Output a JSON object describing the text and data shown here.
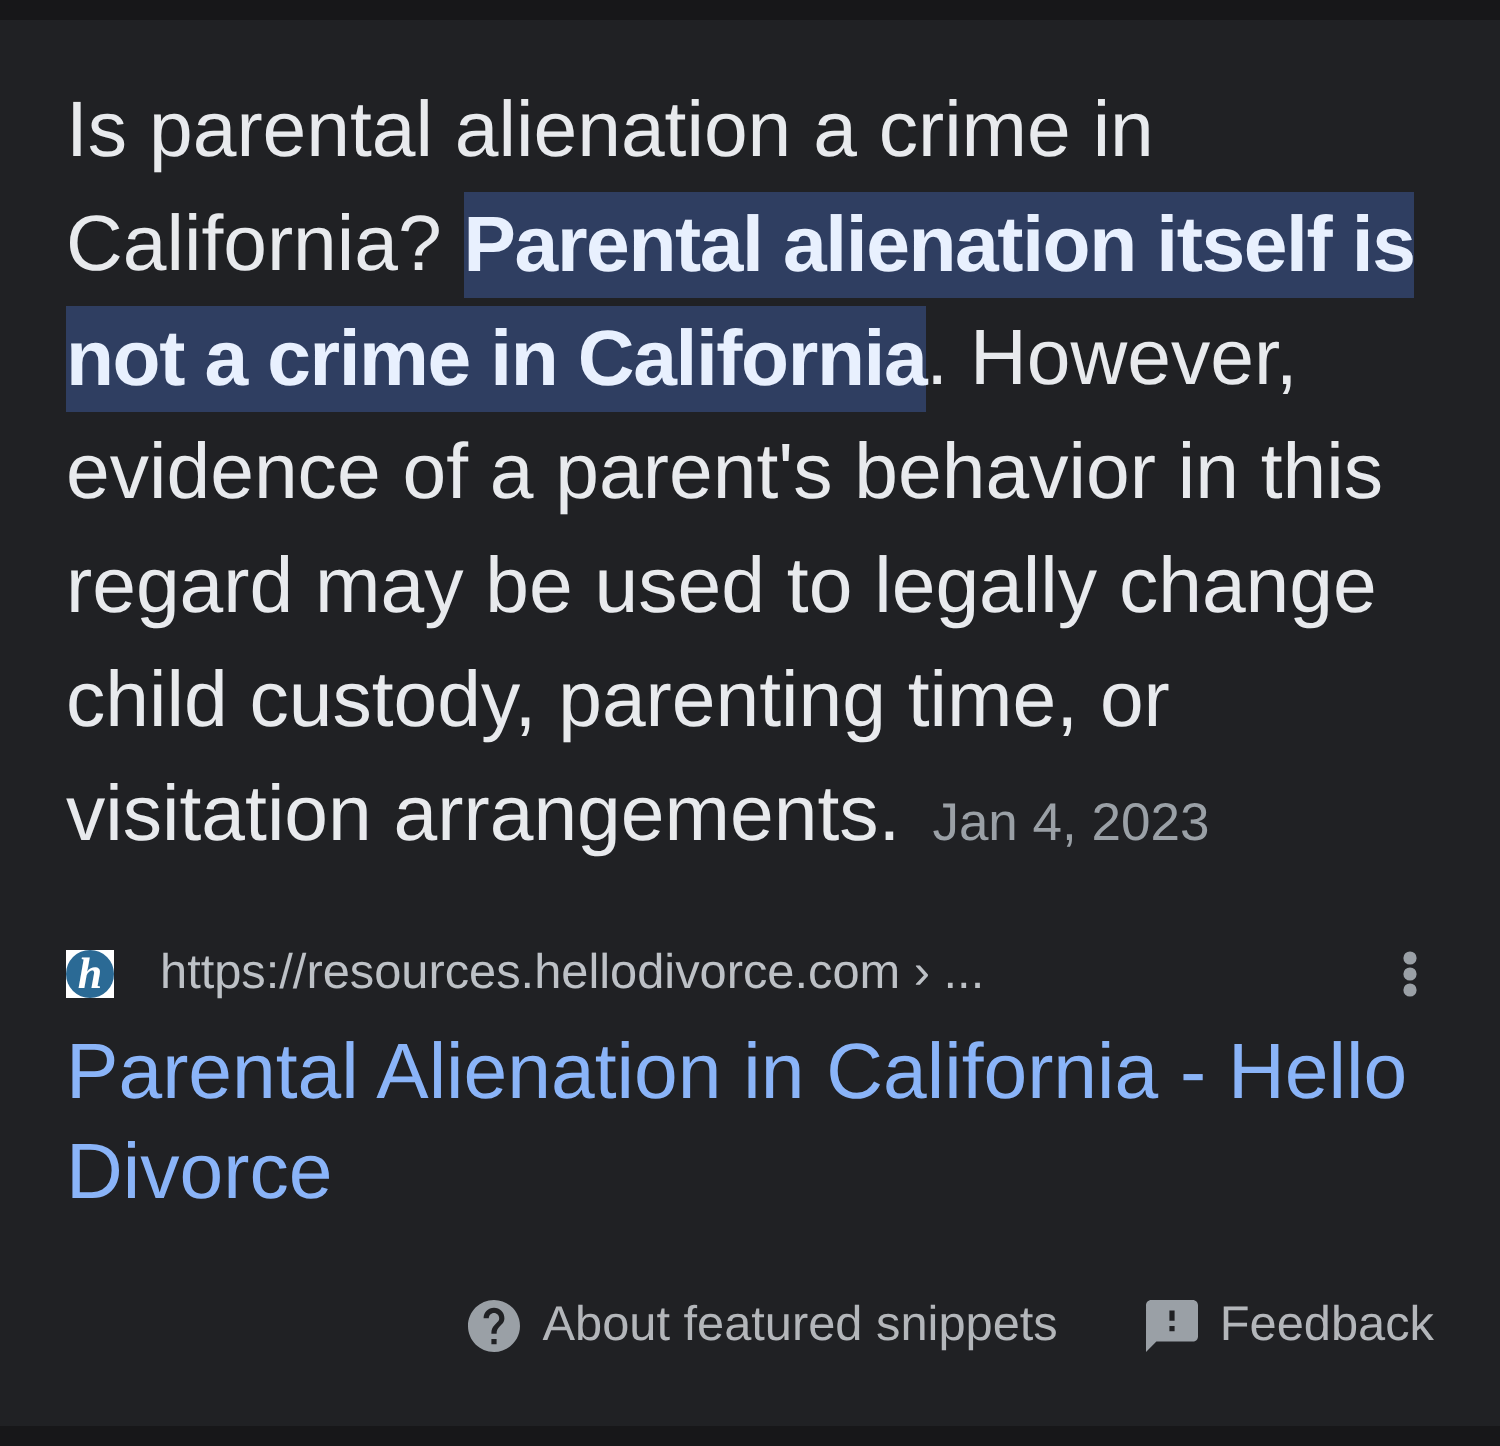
{
  "snippet": {
    "text": "Is parental alienation a crime in California? **Parental alienation itself is not a crime in California**. However, evidence of a parent's behavior in this regard may be used to legally change child custody, parenting time, or visitation arrangements.",
    "date": "Jan 4, 2023"
  },
  "source": {
    "favicon_letter": "h",
    "url": "https://resources.hellodivorce.com › ...",
    "title": "Parental Alienation in California - Hello Divorce"
  },
  "footer": [
    {
      "kind": "help",
      "label": "About featured snippets"
    },
    {
      "kind": "feedback",
      "label": "Feedback"
    }
  ]
}
